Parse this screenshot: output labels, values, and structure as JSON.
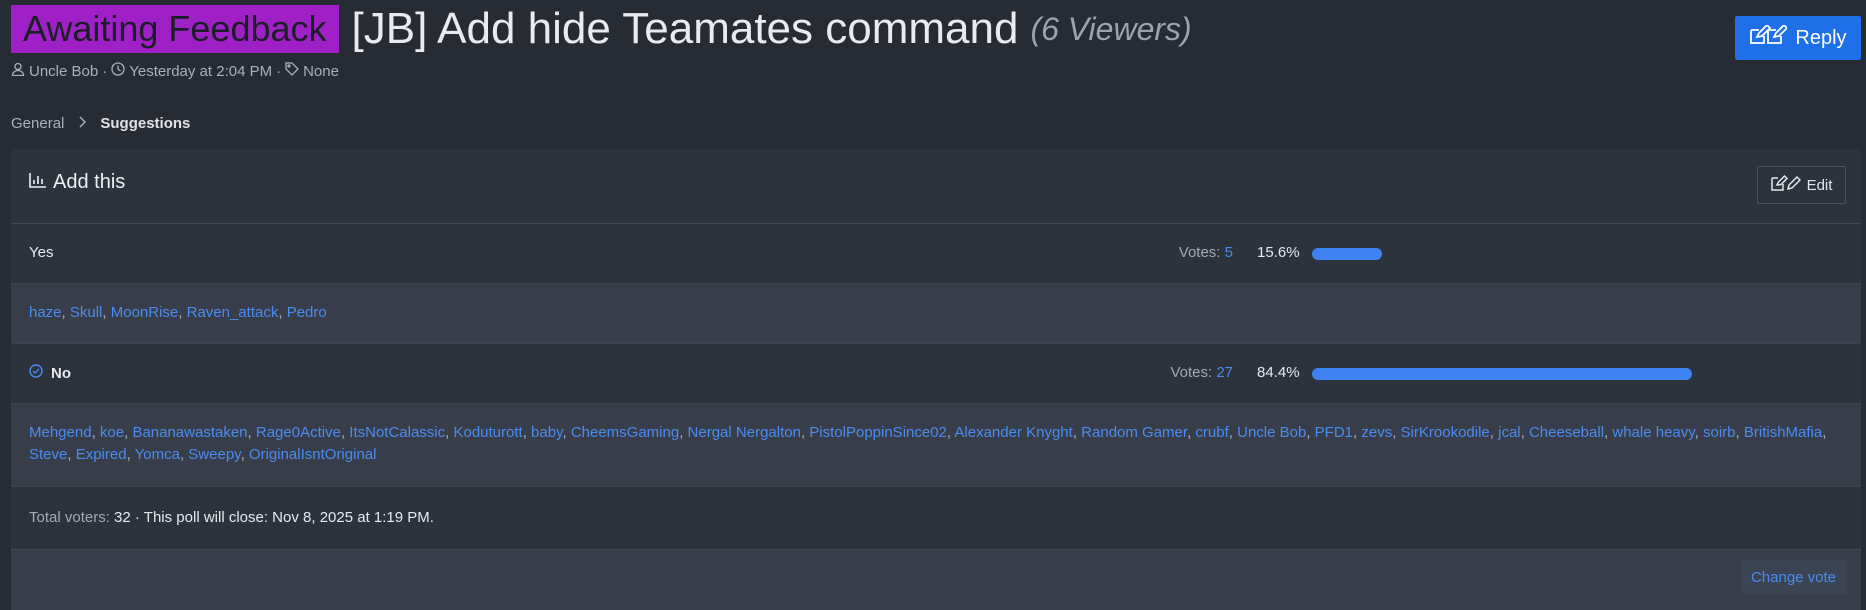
{
  "thread": {
    "prefix": "Awaiting Feedback",
    "title": "[JB] Add hide Teamates command",
    "viewers": "(6 Viewers)",
    "author": "Uncle Bob",
    "sep1": "·",
    "date": "Yesterday at 2:04 PM",
    "sep2": "·",
    "tags": "None"
  },
  "reply_button": "Reply",
  "breadcrumb": [
    "General",
    "Suggestions"
  ],
  "poll": {
    "title": "Add this",
    "edit_label": "Edit",
    "votes_label": "Votes:",
    "options": [
      {
        "label": "Yes",
        "votes": "5",
        "percent": "15.6%",
        "fraction": 0.156,
        "voted": false
      },
      {
        "label": "No",
        "votes": "27",
        "percent": "84.4%",
        "fraction": 0.844,
        "voted": true
      }
    ],
    "voters_yes": [
      "haze",
      "Skull",
      "MoonRise",
      "Raven_attack",
      "Pedro"
    ],
    "voters_no": [
      "Mehgend",
      "koe",
      "Bananawastaken",
      "Rage0Active",
      "ItsNotCalassic",
      "Koduturott",
      "baby",
      "CheemsGaming",
      "Nergal Nergalton",
      "PistolPoppinSince02",
      "Alexander Knyght",
      "Random Gamer",
      "crubf",
      "Uncle Bob",
      "PFD1",
      "zevs",
      "SirKrookodile",
      "jcal",
      "Cheeseball",
      "whale heavy",
      "soirb",
      "BritishMafia",
      "Steve",
      "Expired",
      "Yomca",
      "Sweepy",
      "OriginalIsntOriginal"
    ],
    "total_label": "Total voters:",
    "total_voters": "32",
    "close_text": "· This poll will close: Nov 8, 2025 at 1:19 PM.",
    "change_vote": "Change vote"
  },
  "colors": {
    "prefix_bg": "#a020c8",
    "accent": "#1e6fe8",
    "link": "#4a8cf0",
    "bar": "#3f82f1"
  }
}
